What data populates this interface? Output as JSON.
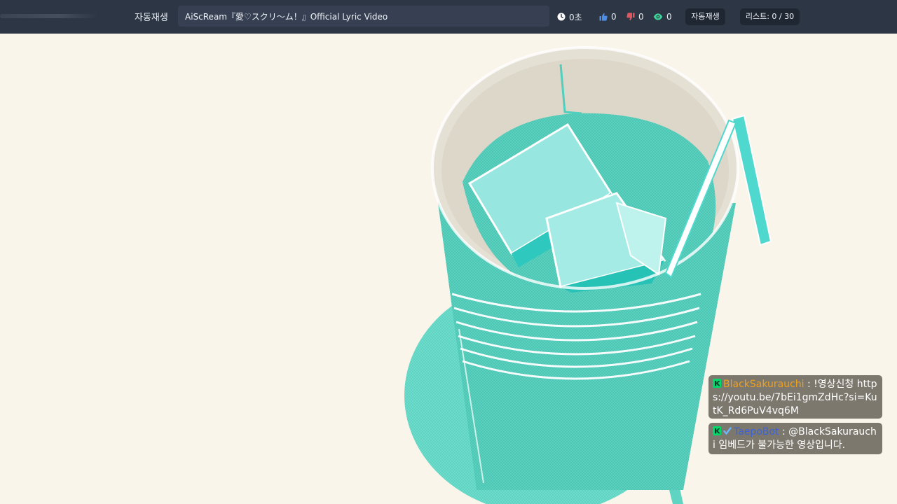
{
  "topbar": {
    "autoplay_label": "자동재생",
    "video_title": "AiScReam『愛♡スクリ～ム！』Official Lyric Video",
    "duration": "0초",
    "likes": "0",
    "dislikes": "0",
    "views": "0",
    "autoplay_button": "자동재생",
    "list_button": "리스트: 0 / 30"
  },
  "colors": {
    "background": "#faf5ea",
    "topbar": "#2d3644",
    "accent_teal": "#4fd0be",
    "like_blue": "#4a8ee8",
    "dislike_red": "#e0575f",
    "view_green": "#3fd49a"
  },
  "chat": [
    {
      "badge_icon": "chzzk-icon",
      "username": "BlackSakurauchi",
      "message": " : !영상신청 https://youtu.be/7bEi1gmZdHc?si=KutK_Rd6PuV4vq6M"
    },
    {
      "badge_icon": "chzzk-icon",
      "badge2_icon": "verified-check-icon",
      "username": "TaepoBot",
      "message": " : @BlackSakurauchi 임베드가 불가능한 영상입니다."
    }
  ]
}
